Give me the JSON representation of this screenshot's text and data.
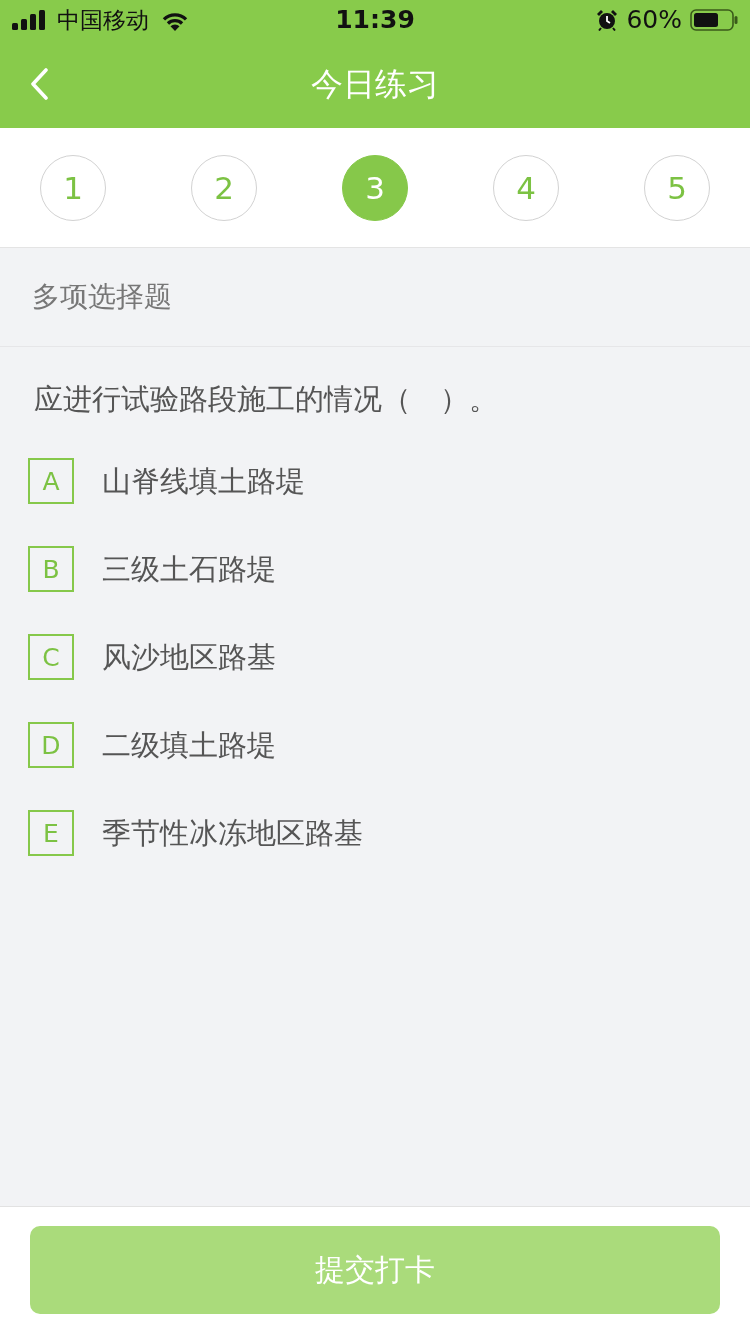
{
  "status_bar": {
    "carrier": "中国移动",
    "time": "11:39",
    "battery": "60%"
  },
  "nav_bar": {
    "title": "今日练习"
  },
  "steps": [
    {
      "label": "1",
      "selected": false
    },
    {
      "label": "2",
      "selected": false
    },
    {
      "label": "3",
      "selected": true
    },
    {
      "label": "4",
      "selected": false
    },
    {
      "label": "5",
      "selected": false
    }
  ],
  "question": {
    "type": "多项选择题",
    "text": "应进行试验路段施工的情况（　）。",
    "options": [
      {
        "letter": "A",
        "text": "山脊线填土路堤",
        "selected": false
      },
      {
        "letter": "B",
        "text": "三级土石路堤",
        "selected": false
      },
      {
        "letter": "C",
        "text": "风沙地区路基",
        "selected": false
      },
      {
        "letter": "D",
        "text": "二级填土路堤",
        "selected": false
      },
      {
        "letter": "E",
        "text": "季节性冰冻地区路基",
        "selected": false
      }
    ]
  },
  "submit_button": {
    "label": "提交打卡",
    "disabled": true
  }
}
